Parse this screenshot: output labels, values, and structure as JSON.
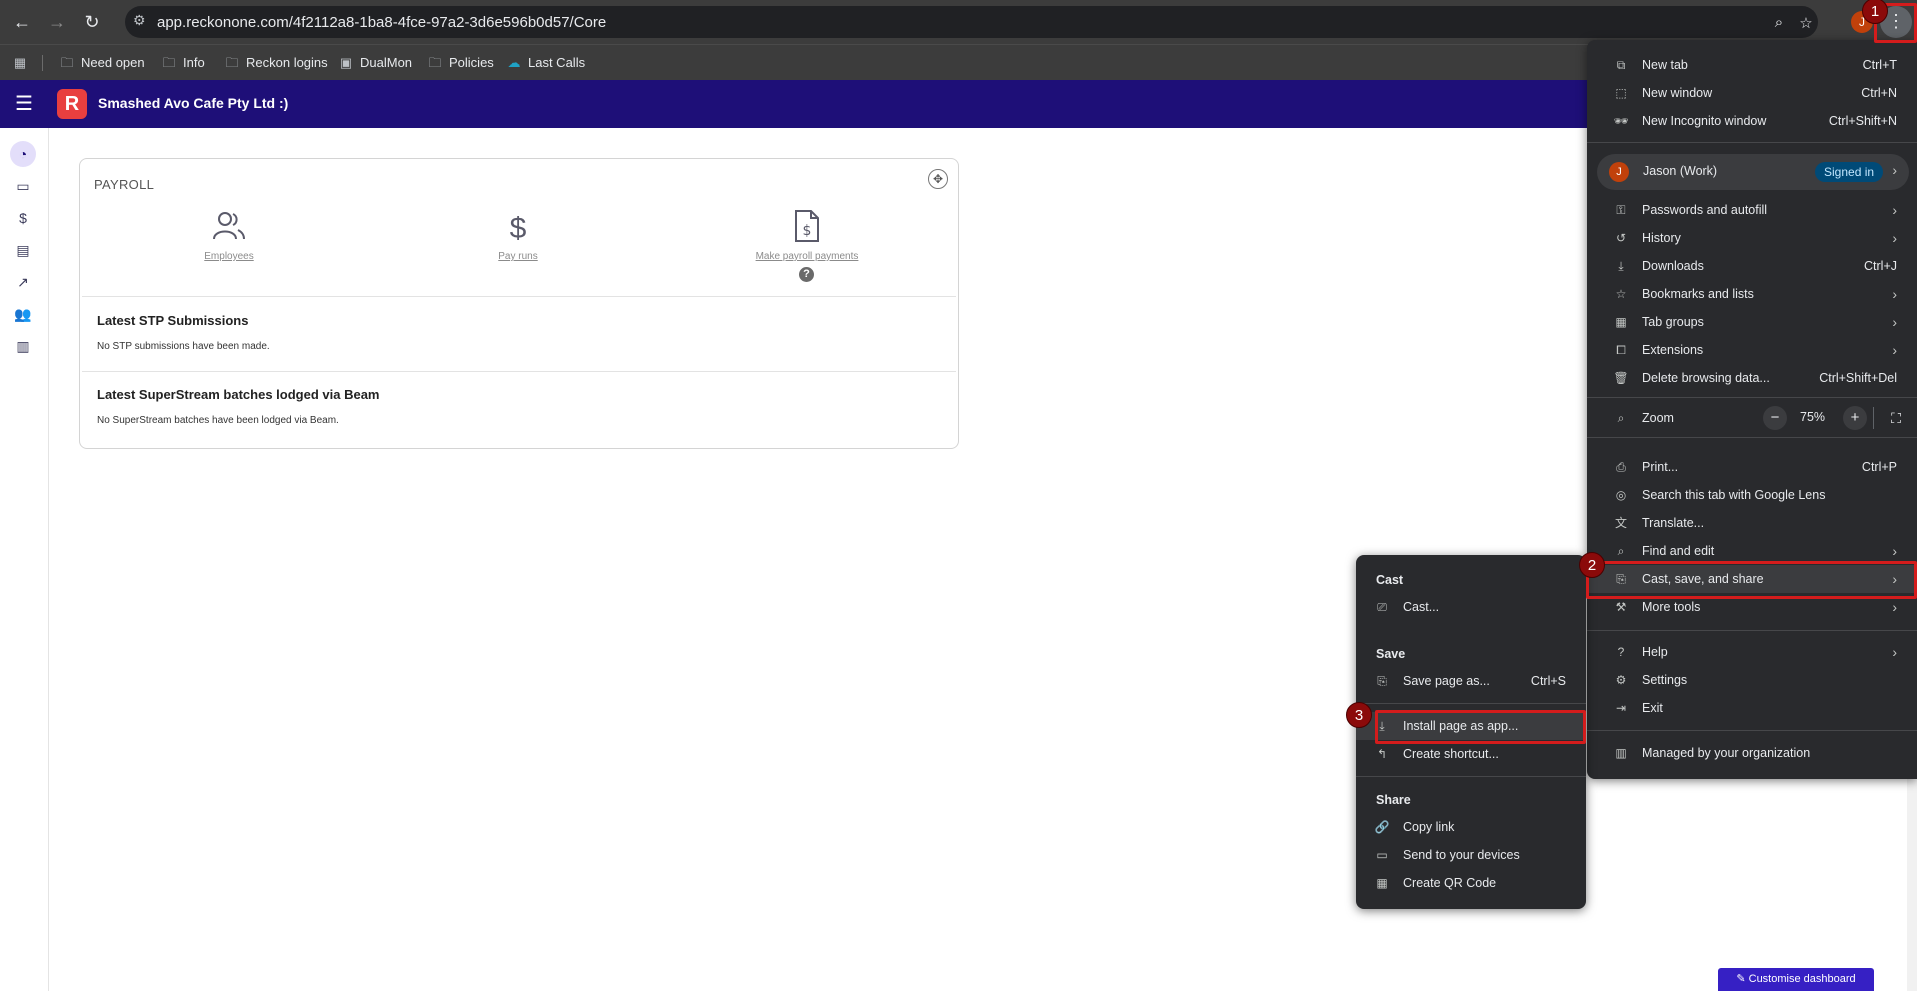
{
  "browser": {
    "url": "app.reckonone.com/4f2112a8-1ba8-4fce-97a2-3d6e596b0d57/Core",
    "avatar_initial": "J",
    "icons": [
      "back-arrow-icon",
      "forward-arrow-icon",
      "reload-icon",
      "site-settings-icon",
      "zoom-icon",
      "star-icon",
      "more-vert-icon"
    ]
  },
  "bookmarks": [
    {
      "label": "Need open",
      "icon": "folder-icon"
    },
    {
      "label": "Info",
      "icon": "folder-icon"
    },
    {
      "label": "Reckon logins",
      "icon": "folder-icon"
    },
    {
      "label": "DualMon",
      "icon": "image-icon"
    },
    {
      "label": "Policies",
      "icon": "folder-icon"
    },
    {
      "label": "Last Calls",
      "icon": "cloud-icon"
    }
  ],
  "app": {
    "company": "Smashed Avo Cafe Pty Ltd :)",
    "logo_letter": "R",
    "accent": "#1e0f78",
    "customise_label": "Customise dashboard"
  },
  "sidebar_icons": [
    "dashboard-icon",
    "calendar-icon",
    "dollar-icon",
    "briefcase-icon",
    "trending-icon",
    "people-icon",
    "archive-icon"
  ],
  "payroll": {
    "title": "PAYROLL",
    "tiles": [
      {
        "label": "Employees",
        "icon": "people-icon"
      },
      {
        "label": "Pay runs",
        "icon": "dollar-icon"
      },
      {
        "label": "Make payroll payments",
        "icon": "document-dollar-icon"
      }
    ],
    "stp_heading": "Latest STP Submissions",
    "stp_text": "No STP submissions have been made.",
    "super_heading": "Latest SuperStream batches lodged via Beam",
    "super_text": "No SuperStream batches have been lodged via Beam."
  },
  "menu": {
    "new_tab": {
      "label": "New tab",
      "shortcut": "Ctrl+T"
    },
    "new_window": {
      "label": "New window",
      "shortcut": "Ctrl+N"
    },
    "incognito": {
      "label": "New Incognito window",
      "shortcut": "Ctrl+Shift+N"
    },
    "profile": {
      "name": "Jason (Work)",
      "status": "Signed in",
      "initial": "J"
    },
    "passwords": {
      "label": "Passwords and autofill"
    },
    "history": {
      "label": "History"
    },
    "downloads": {
      "label": "Downloads",
      "shortcut": "Ctrl+J"
    },
    "bookmarks": {
      "label": "Bookmarks and lists"
    },
    "tab_groups": {
      "label": "Tab groups"
    },
    "extensions": {
      "label": "Extensions"
    },
    "delete_data": {
      "label": "Delete browsing data...",
      "shortcut": "Ctrl+Shift+Del"
    },
    "zoom": {
      "label": "Zoom",
      "value": "75%",
      "minus": "−",
      "plus": "+"
    },
    "print": {
      "label": "Print...",
      "shortcut": "Ctrl+P"
    },
    "lens": {
      "label": "Search this tab with Google Lens"
    },
    "translate": {
      "label": "Translate..."
    },
    "find": {
      "label": "Find and edit"
    },
    "cast_save_share": {
      "label": "Cast, save, and share"
    },
    "more_tools": {
      "label": "More tools"
    },
    "help": {
      "label": "Help"
    },
    "settings": {
      "label": "Settings"
    },
    "exit": {
      "label": "Exit"
    },
    "managed": {
      "label": "Managed by your organization"
    }
  },
  "submenu": {
    "cast_heading": "Cast",
    "cast": {
      "label": "Cast..."
    },
    "save_heading": "Save",
    "save_page": {
      "label": "Save page as...",
      "shortcut": "Ctrl+S"
    },
    "install": {
      "label": "Install page as app..."
    },
    "shortcut": {
      "label": "Create shortcut..."
    },
    "share_heading": "Share",
    "copy_link": {
      "label": "Copy link"
    },
    "send": {
      "label": "Send to your devices"
    },
    "qr": {
      "label": "Create QR Code"
    }
  },
  "markers": [
    "1",
    "2",
    "3"
  ],
  "highlight_color": "#d41c1c"
}
